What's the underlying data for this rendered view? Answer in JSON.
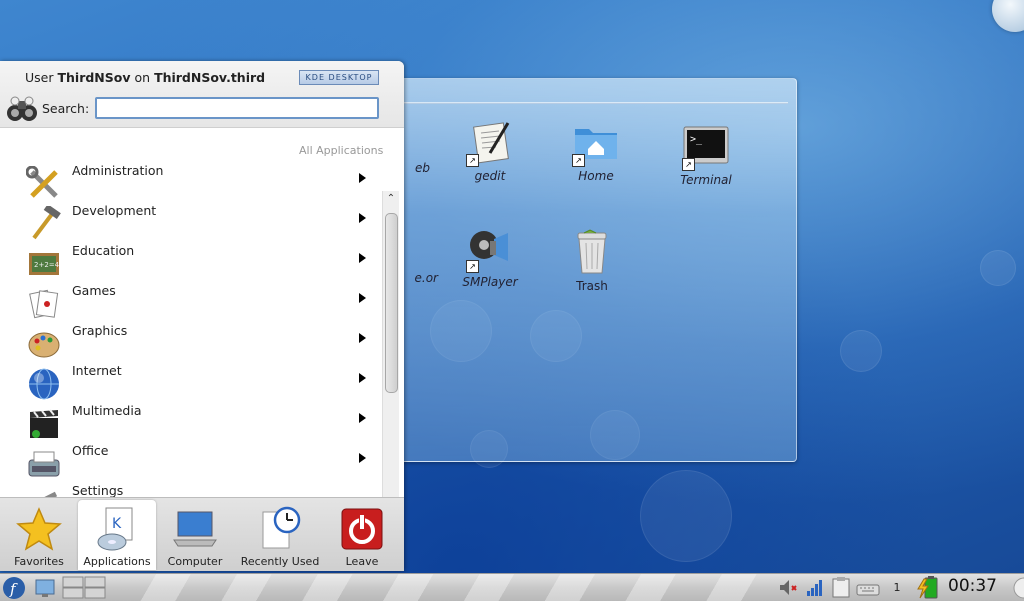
{
  "desktop": {
    "folder_icons": [
      {
        "label": "eb",
        "icon": "konqueror-link-icon"
      },
      {
        "label": "gedit",
        "icon": "text-editor-icon"
      },
      {
        "label": "Home",
        "icon": "home-folder-icon"
      },
      {
        "label": "Terminal",
        "icon": "terminal-icon"
      },
      {
        "label": "e.or",
        "icon": "openoffice-link-icon"
      },
      {
        "label": "SMPlayer",
        "icon": "smplayer-icon"
      },
      {
        "label": "Trash",
        "icon": "trash-icon"
      }
    ]
  },
  "kickoff": {
    "user_prefix": "User",
    "user_name": "ThirdNSov",
    "on_word": "on",
    "host_name": "ThirdNSov.third",
    "badge": "KDE DESKTOP",
    "search_label": "Search:",
    "search_value": "",
    "section_title": "All Applications",
    "apps": [
      {
        "label": "Administration",
        "icon": "administration-icon"
      },
      {
        "label": "Development",
        "icon": "development-icon"
      },
      {
        "label": "Education",
        "icon": "education-icon"
      },
      {
        "label": "Games",
        "icon": "games-icon"
      },
      {
        "label": "Graphics",
        "icon": "graphics-icon"
      },
      {
        "label": "Internet",
        "icon": "internet-icon"
      },
      {
        "label": "Multimedia",
        "icon": "multimedia-icon"
      },
      {
        "label": "Office",
        "icon": "office-icon"
      },
      {
        "label": "Settings",
        "icon": "settings-icon"
      }
    ],
    "tabs": [
      {
        "label": "Favorites",
        "icon": "star-icon",
        "active": false
      },
      {
        "label": "Applications",
        "icon": "applications-icon",
        "active": true
      },
      {
        "label": "Computer",
        "icon": "computer-icon",
        "active": false
      },
      {
        "label": "Recently Used",
        "icon": "clock-icon",
        "active": false
      },
      {
        "label": "Leave",
        "icon": "power-icon",
        "active": false
      }
    ]
  },
  "panel": {
    "clock": "00:37",
    "pager_count": "1",
    "tray_icons": [
      "volume-muted-icon",
      "network-icon",
      "clipboard-icon",
      "keyboard-icon",
      "battery-icon"
    ]
  }
}
